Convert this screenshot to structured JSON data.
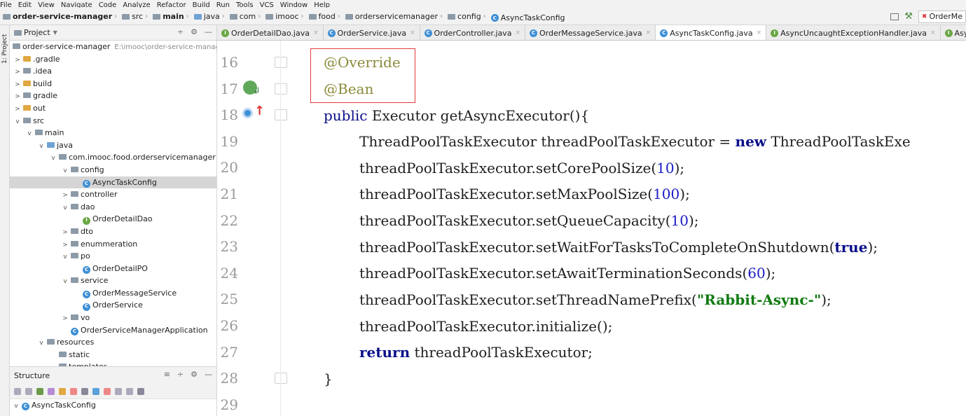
{
  "menu": [
    "File",
    "Edit",
    "View",
    "Navigate",
    "Code",
    "Analyze",
    "Refactor",
    "Build",
    "Run",
    "Tools",
    "VCS",
    "Window",
    "Help"
  ],
  "breadcrumb": [
    "order-service-manager",
    "src",
    "main",
    "java",
    "com",
    "imooc",
    "food",
    "orderservicemanager",
    "config",
    "AsyncTaskConfig"
  ],
  "run_config": "OrderMe",
  "project_panel": {
    "title": "Project",
    "root_name": "order-service-manager",
    "root_path": "E:\\imooc\\order-service-manag",
    "items": [
      {
        "label": ".gradle",
        "indent": 1,
        "arrow": ">",
        "icon": "folder-yellow"
      },
      {
        "label": ".idea",
        "indent": 1,
        "arrow": ">",
        "icon": "folder"
      },
      {
        "label": "build",
        "indent": 1,
        "arrow": ">",
        "icon": "folder-yellow"
      },
      {
        "label": "gradle",
        "indent": 1,
        "arrow": ">",
        "icon": "folder"
      },
      {
        "label": "out",
        "indent": 1,
        "arrow": ">",
        "icon": "folder-yellow"
      },
      {
        "label": "src",
        "indent": 1,
        "arrow": "v",
        "icon": "folder"
      },
      {
        "label": "main",
        "indent": 2,
        "arrow": "v",
        "icon": "folder"
      },
      {
        "label": "java",
        "indent": 3,
        "arrow": "v",
        "icon": "folder-blue"
      },
      {
        "label": "com.imooc.food.orderservicemanager",
        "indent": 4,
        "arrow": "v",
        "icon": "folder"
      },
      {
        "label": "config",
        "indent": 5,
        "arrow": "v",
        "icon": "folder"
      },
      {
        "label": "AsyncTaskConfig",
        "indent": 6,
        "arrow": "",
        "icon": "class",
        "selected": true
      },
      {
        "label": "controller",
        "indent": 5,
        "arrow": ">",
        "icon": "folder"
      },
      {
        "label": "dao",
        "indent": 5,
        "arrow": "v",
        "icon": "folder"
      },
      {
        "label": "OrderDetailDao",
        "indent": 6,
        "arrow": "",
        "icon": "interface"
      },
      {
        "label": "dto",
        "indent": 5,
        "arrow": ">",
        "icon": "folder"
      },
      {
        "label": "enummeration",
        "indent": 5,
        "arrow": ">",
        "icon": "folder"
      },
      {
        "label": "po",
        "indent": 5,
        "arrow": "v",
        "icon": "folder"
      },
      {
        "label": "OrderDetailPO",
        "indent": 6,
        "arrow": "",
        "icon": "class"
      },
      {
        "label": "service",
        "indent": 5,
        "arrow": "v",
        "icon": "folder"
      },
      {
        "label": "OrderMessageService",
        "indent": 6,
        "arrow": "",
        "icon": "class"
      },
      {
        "label": "OrderService",
        "indent": 6,
        "arrow": "",
        "icon": "class"
      },
      {
        "label": "vo",
        "indent": 5,
        "arrow": ">",
        "icon": "folder"
      },
      {
        "label": "OrderServiceManagerApplication",
        "indent": 5,
        "arrow": "",
        "icon": "class"
      },
      {
        "label": "resources",
        "indent": 3,
        "arrow": "v",
        "icon": "folder"
      },
      {
        "label": "static",
        "indent": 4,
        "arrow": "",
        "icon": "folder"
      },
      {
        "label": "templates",
        "indent": 4,
        "arrow": "",
        "icon": "folder"
      }
    ]
  },
  "structure_panel": {
    "title": "Structure",
    "root": "AsyncTaskConfig"
  },
  "side_tab": "1: Project",
  "tabs": [
    {
      "label": "OrderDetailDao.java",
      "icon": "interface",
      "active": false
    },
    {
      "label": "OrderService.java",
      "icon": "class",
      "active": false
    },
    {
      "label": "OrderController.java",
      "icon": "class",
      "active": false
    },
    {
      "label": "OrderMessageService.java",
      "icon": "class",
      "active": false
    },
    {
      "label": "AsyncTaskConfig.java",
      "icon": "class",
      "active": true
    },
    {
      "label": "AsyncUncaughtExceptionHandler.java",
      "icon": "interface",
      "active": false
    },
    {
      "label": "AsyncConfigurer.java",
      "icon": "interface",
      "active": false
    }
  ],
  "code": {
    "line_numbers": [
      "16",
      "17",
      "18",
      "19",
      "20",
      "21",
      "22",
      "23",
      "24",
      "25",
      "26",
      "27",
      "28",
      "29"
    ],
    "l16": "@Override",
    "l17": "@Bean",
    "l18_kw": "public",
    "l18_rest": " Executor getAsyncExecutor(){",
    "l19_a": "ThreadPoolTaskExecutor threadPoolTaskExecutor = ",
    "l19_kw": "new",
    "l19_b": " ThreadPoolTaskExe",
    "l20_a": "threadPoolTaskExecutor.setCorePoolSize(",
    "l20_n": "10",
    "l21_a": "threadPoolTaskExecutor.setMaxPoolSize(",
    "l21_n": "100",
    "l22_a": "threadPoolTaskExecutor.setQueueCapacity(",
    "l22_n": "10",
    "l23_a": "threadPoolTaskExecutor.setWaitForTasksToCompleteOnShutdown(",
    "l23_n": "true",
    "l24_a": "threadPoolTaskExecutor.setAwaitTerminationSeconds(",
    "l24_n": "60",
    "l25_a": "threadPoolTaskExecutor.setThreadNamePrefix(",
    "l25_s": "\"Rabbit-Async-\"",
    "l26": "threadPoolTaskExecutor.initialize();",
    "l27_kw": "return",
    "l27_rest": " threadPoolTaskExecutor;",
    "l28": "}",
    "close": ");"
  },
  "colors": {
    "keyword": "#0a0f8a",
    "annotation": "#8a8a3a",
    "number": "#1b1bc4",
    "string": "#107a10",
    "highlight_box": "#e53b3b"
  }
}
